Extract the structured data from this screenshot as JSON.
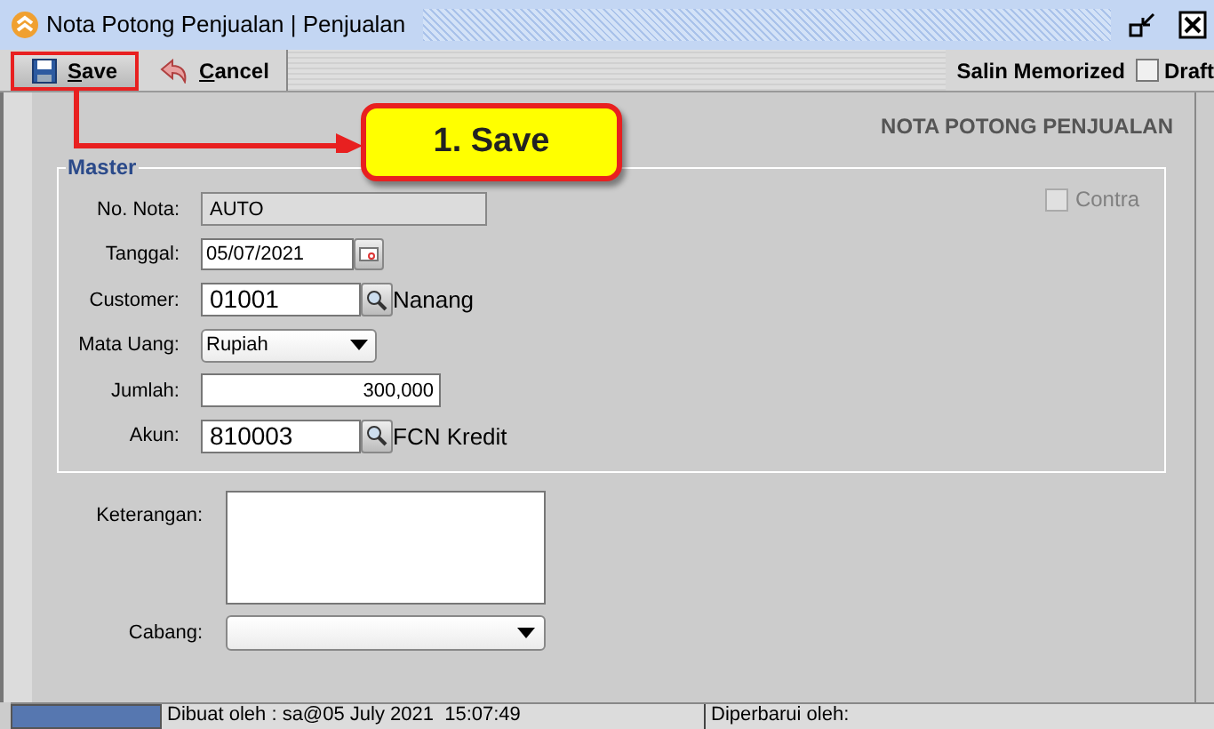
{
  "window": {
    "title": "Nota Potong Penjualan | Penjualan"
  },
  "toolbar": {
    "buttons": [
      {
        "label": "Save",
        "kind": "save",
        "highlighted": true
      },
      {
        "label": "Cancel",
        "kind": "cancel",
        "highlighted": false
      }
    ],
    "salin_memorized": "Salin Memorized",
    "draft": {
      "label": "Draft",
      "checked": false
    }
  },
  "heading": "NOTA POTONG PENJUALAN",
  "callout": {
    "text": "1. Save"
  },
  "master": {
    "legend": "Master",
    "contra": {
      "label": "Contra",
      "checked": false,
      "disabled": true
    },
    "fields": [
      {
        "label": "No. Nota:",
        "kind": "text",
        "value": "AUTO",
        "disabled": true
      },
      {
        "label": "Tanggal:",
        "kind": "date",
        "value": "05/07/2021",
        "disabled": false
      },
      {
        "label": "Customer:",
        "kind": "lookup",
        "value": "01001",
        "lookup_text": "Nanang",
        "disabled": false
      },
      {
        "label": "Mata Uang:",
        "kind": "select",
        "value": "Rupiah",
        "disabled": false
      },
      {
        "label": "Jumlah:",
        "kind": "number",
        "value": "300,000",
        "disabled": false
      },
      {
        "label": "Akun:",
        "kind": "lookup",
        "value": "810003",
        "lookup_text": "FCN Kredit",
        "disabled": false
      }
    ]
  },
  "keterangan": {
    "label": "Keterangan:"
  },
  "cabang": {
    "label": "Cabang:"
  },
  "status_bar": [
    "Dibuat oleh : sa@05 July 2021  15:07:49",
    "Diperbarui oleh:"
  ]
}
